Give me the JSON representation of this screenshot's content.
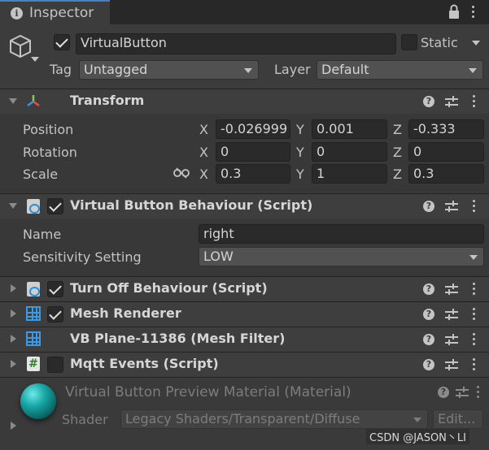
{
  "tab": {
    "title": "Inspector"
  },
  "gameobject": {
    "name": "VirtualButton",
    "active": true,
    "static_label": "Static",
    "tag_label": "Tag",
    "tag_value": "Untagged",
    "layer_label": "Layer",
    "layer_value": "Default"
  },
  "transform": {
    "title": "Transform",
    "position_label": "Position",
    "rotation_label": "Rotation",
    "scale_label": "Scale",
    "x": "X",
    "y": "Y",
    "z": "Z",
    "position": {
      "x": "-0.026999",
      "y": "0.001",
      "z": "-0.333"
    },
    "rotation": {
      "x": "0",
      "y": "0",
      "z": "0"
    },
    "scale": {
      "x": "0.3",
      "y": "1",
      "z": "0.3"
    }
  },
  "vb_behaviour": {
    "title": "Virtual Button Behaviour (Script)",
    "enabled": true,
    "name_label": "Name",
    "name_value": "right",
    "sensitivity_label": "Sensitivity Setting",
    "sensitivity_value": "LOW"
  },
  "components": [
    {
      "title": "Turn Off Behaviour (Script)",
      "icon": "script-icon",
      "enabled": true
    },
    {
      "title": "Mesh Renderer",
      "icon": "mesh-renderer-icon",
      "enabled": true
    },
    {
      "title": "VB Plane-11386 (Mesh Filter)",
      "icon": "mesh-filter-icon"
    },
    {
      "title": "Mqtt Events (Script)",
      "icon": "csharp-script-icon",
      "enabled": false
    }
  ],
  "material": {
    "title": "Virtual Button Preview Material (Material)",
    "shader_label": "Shader",
    "shader_value": "Legacy Shaders/Transparent/Diffuse",
    "edit_label": "Edit...",
    "sphere_color": "#1aa8a8"
  },
  "watermark": "CSDN @JASON丶LI",
  "colors": {
    "accent": "#4a7fc1",
    "panel": "#383838",
    "field": "#2a2a2a"
  }
}
